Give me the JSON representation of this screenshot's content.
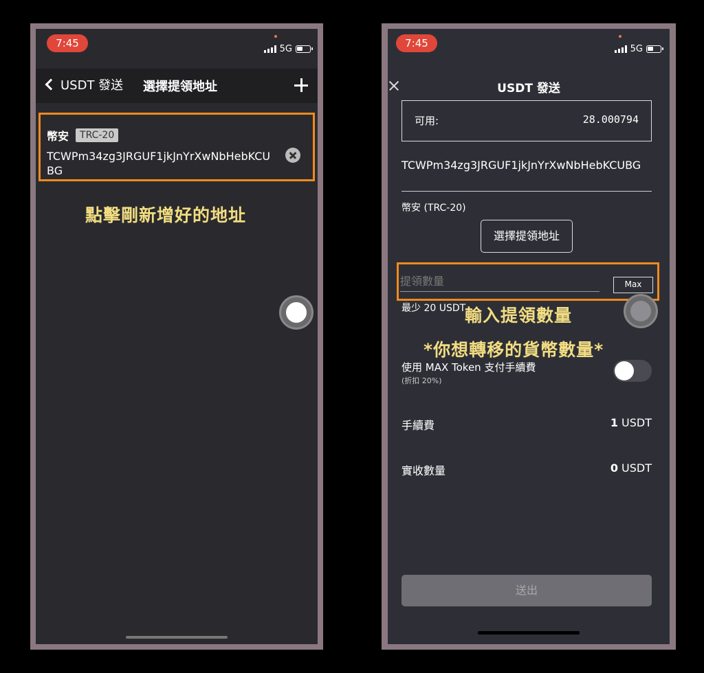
{
  "left": {
    "status": {
      "time": "7:45",
      "network": "5G"
    },
    "nav": {
      "back_label": "USDT 發送",
      "title": "選擇提領地址"
    },
    "address_card": {
      "name": "幣安",
      "network_tag": "TRC-20",
      "address": "TCWPm34zg3JRGUF1jkJnYrXwNbHebKCUBG"
    },
    "annotation": "點擊剛新增好的地址"
  },
  "right": {
    "status": {
      "time": "7:45",
      "network": "5G"
    },
    "title": "USDT 發送",
    "available": {
      "label": "可用:",
      "value": "28.000794"
    },
    "address": "TCWPm34zg3JRGUF1jkJnYrXwNbHebKCUBG",
    "network_label": "幣安 (TRC-20)",
    "select_address_button": "選擇提領地址",
    "amount": {
      "placeholder": "提領數量",
      "value": "",
      "max_label": "Max"
    },
    "min_note": "最少 20 USDT",
    "annotations": [
      "輸入提領數量",
      "*你想轉移的貨幣數量*"
    ],
    "fee_toggle": {
      "label": "使用 MAX Token 支付手續費",
      "sub": "(折扣 20%)",
      "on": false
    },
    "fee": {
      "label": "手續費",
      "amount": "1",
      "unit": " USDT"
    },
    "receive": {
      "label": "實收數量",
      "amount": "0",
      "unit": " USDT"
    },
    "submit_label": "送出"
  }
}
